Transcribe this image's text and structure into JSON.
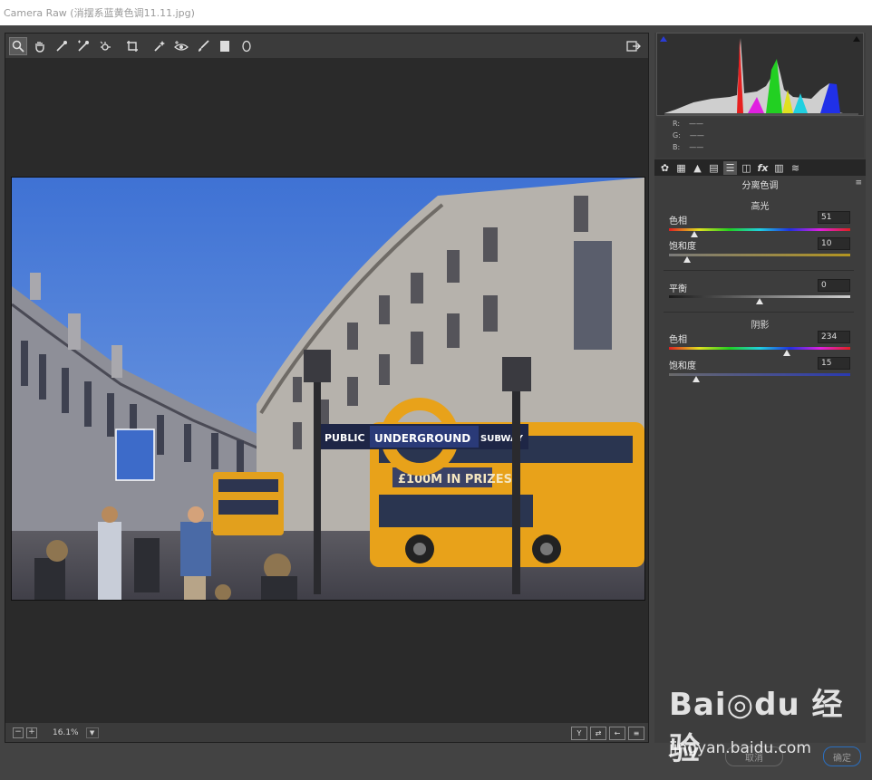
{
  "window": {
    "title": "Camera Raw (消摆系蓝黄色调11.11.jpg)"
  },
  "toolbar": {
    "tools": [
      {
        "icon": "zoom-icon",
        "glyph": "🔍",
        "active": true
      },
      {
        "icon": "hand-icon",
        "glyph": "✋"
      },
      {
        "icon": "white-balance-icon",
        "glyph": "↗"
      },
      {
        "icon": "color-sampler-icon",
        "glyph": "↗"
      },
      {
        "icon": "target-adjust-icon",
        "glyph": "⌖"
      },
      {
        "icon": "crop-icon",
        "glyph": "⬚"
      },
      {
        "icon": "spot-removal-icon",
        "glyph": "✶"
      },
      {
        "icon": "red-eye-icon",
        "glyph": "◉"
      },
      {
        "icon": "adjustment-brush-icon",
        "glyph": "✐"
      },
      {
        "icon": "graduated-filter-icon",
        "glyph": "▮"
      },
      {
        "icon": "radial-filter-icon",
        "glyph": "○"
      }
    ],
    "fullscreen_icon": "fullscreen-icon"
  },
  "image": {
    "signs": {
      "public": "PUBLIC",
      "underground": "UNDERGROUND",
      "subway": "SUBWAY"
    },
    "bus_ad": "£100M IN PRIZES"
  },
  "statusbar": {
    "zoom_out": "−",
    "zoom_in": "+",
    "zoom": "16.1%",
    "view_buttons": [
      "Y",
      "⇄",
      "←",
      "≡"
    ]
  },
  "readout": {
    "r_label": "R:",
    "g_label": "G:",
    "b_label": "B:",
    "r": "——",
    "g": "——",
    "b": "——"
  },
  "tabs": [
    "basic-tab-icon",
    "tone-curve-icon",
    "detail-icon",
    "hsl-icon",
    "split-toning-icon",
    "lens-corrections-icon",
    "fx-icon",
    "camera-calibration-icon",
    "presets-icon"
  ],
  "panel": {
    "title": "分离色调",
    "highlights": {
      "heading": "高光",
      "hue_label": "色相",
      "hue": "51",
      "hue_pct": 0.142,
      "sat_label": "饱和度",
      "sat": "10",
      "sat_pct": 0.1
    },
    "balance": {
      "label": "平衡",
      "value": "0",
      "pct": 0.5
    },
    "shadows": {
      "heading": "阴影",
      "hue_label": "色相",
      "hue": "234",
      "hue_pct": 0.65,
      "sat_label": "饱和度",
      "sat": "15",
      "sat_pct": 0.15
    }
  },
  "footer": {
    "cancel": "取消",
    "ok": "确定"
  },
  "watermark": {
    "brand": "Bai◎du 经验",
    "url": "jingyan.baidu.com"
  },
  "colors": {
    "accent_blue": "#1e2fd0",
    "bus_yellow": "#e8a21a",
    "sky": "#4a7fd8"
  }
}
